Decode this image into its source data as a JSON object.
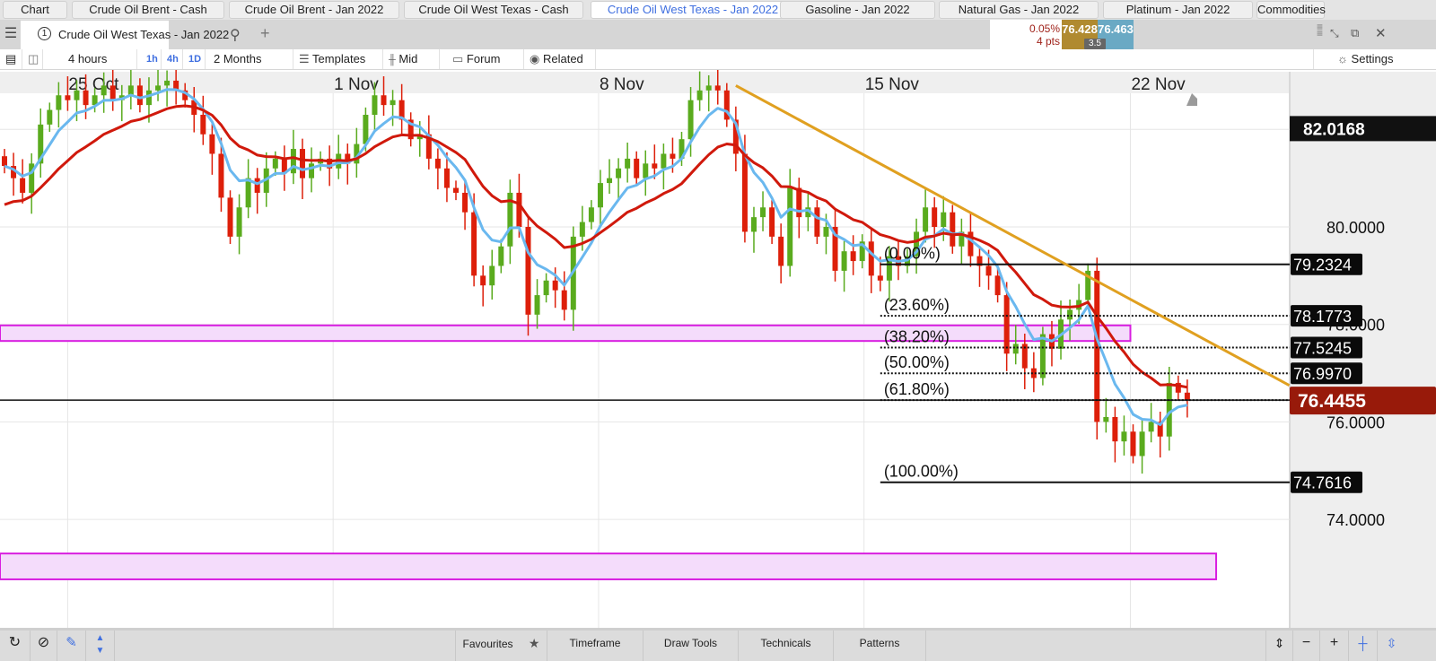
{
  "tabs": [
    {
      "label": "Chart",
      "active": false
    },
    {
      "label": "Crude Oil Brent - Cash",
      "active": false
    },
    {
      "label": "Crude Oil Brent - Jan 2022",
      "active": false
    },
    {
      "label": "Crude Oil West Texas - Cash",
      "active": false
    },
    {
      "label": "Crude Oil West Texas - Jan 2022",
      "active": true
    },
    {
      "label": "Gasoline - Jan 2022",
      "active": false
    },
    {
      "label": "Natural Gas - Jan 2022",
      "active": false
    },
    {
      "label": "Platinum - Jan 2022",
      "active": false
    },
    {
      "label": "Commodities",
      "active": false
    }
  ],
  "instrument": {
    "number": "1",
    "name": "Crude Oil West Texas - Jan 2022",
    "add_label": "+"
  },
  "quote": {
    "change_pct": "0.05%",
    "change_pts": "4 pts",
    "direction": "down",
    "sell": "76.428",
    "buy": "76.463",
    "spread": "3.5",
    "sell_color": "#b08a30",
    "buy_color": "#6aa9c4"
  },
  "toolbar": {
    "interval": "4 hours",
    "quick_intervals": [
      "1h",
      "4h",
      "1D"
    ],
    "range": "2 Months",
    "templates": "Templates",
    "price_type": "Mid",
    "forum": "Forum",
    "related": "Related",
    "settings": "Settings"
  },
  "bottom_bar": {
    "favourites": "Favourites",
    "timeframe": "Timeframe",
    "draw_tools": "Draw Tools",
    "technicals": "Technicals",
    "patterns": "Patterns"
  },
  "chart_data": {
    "type": "candlestick",
    "interval": "4 hours",
    "up_color": "#5aab1e",
    "down_color": "#dd1f0a",
    "x_ticks": [
      {
        "label": "25 Oct",
        "index": 7
      },
      {
        "label": "1 Nov",
        "index": 36.4
      },
      {
        "label": "8 Nov",
        "index": 65.8
      },
      {
        "label": "15 Nov",
        "index": 95.2
      },
      {
        "label": "22 Nov",
        "index": 124.7
      }
    ],
    "y_ticks": [
      "80.0000",
      "78.0000",
      "76.0000",
      "74.0000"
    ],
    "y_tick_values": [
      80,
      78,
      76,
      74
    ],
    "ylim": [
      71.5,
      83.2
    ],
    "high_label": {
      "value": 82.0168,
      "text": "82.0168"
    },
    "current_price": {
      "value": 76.4455,
      "text": "76.4455",
      "color": "#981a0a"
    },
    "closes": [
      81.25,
      81.0,
      80.7,
      81.3,
      82.1,
      82.4,
      82.7,
      82.6,
      82.8,
      82.5,
      82.7,
      82.9,
      82.6,
      82.7,
      82.9,
      82.5,
      82.8,
      82.9,
      83.0,
      82.8,
      82.6,
      82.3,
      81.9,
      81.5,
      80.6,
      79.8,
      80.4,
      81.0,
      80.7,
      81.2,
      81.4,
      81.1,
      81.6,
      81.0,
      81.3,
      81.4,
      81.2,
      81.5,
      81.3,
      81.7,
      82.3,
      82.7,
      82.5,
      82.6,
      82.2,
      81.8,
      81.9,
      81.4,
      81.2,
      80.8,
      80.7,
      80.3,
      79.0,
      78.8,
      79.2,
      79.6,
      80.7,
      80.0,
      78.2,
      78.6,
      78.9,
      78.7,
      78.3,
      79.8,
      80.1,
      80.4,
      80.9,
      81.0,
      81.2,
      81.4,
      81.0,
      81.3,
      81.2,
      81.5,
      81.4,
      81.8,
      82.6,
      82.8,
      82.9,
      82.8,
      82.2,
      81.5,
      79.9,
      80.2,
      80.4,
      79.8,
      79.2,
      80.8,
      80.2,
      80.4,
      79.8,
      80.0,
      79.1,
      79.5,
      79.3,
      79.7,
      79.0,
      78.9,
      79.4,
      79.2,
      79.4,
      79.9,
      80.4,
      80.0,
      80.3,
      79.6,
      79.9,
      79.4,
      79.2,
      79.0,
      78.6,
      77.4,
      77.6,
      77.1,
      76.9,
      77.8,
      77.5,
      78.1,
      78.3,
      78.5,
      79.1,
      76.0,
      76.1,
      75.6,
      75.8,
      75.3,
      75.8,
      76.0,
      75.7,
      76.8,
      76.6,
      76.45
    ],
    "moving_averages": [
      {
        "color": "#6ab8ef",
        "kind": "fast"
      },
      {
        "color": "#d0190c",
        "kind": "slow"
      }
    ],
    "trendline": {
      "color": "#e0a020",
      "start": {
        "index": 81,
        "price": 82.9
      },
      "end": {
        "index": 142.3,
        "price": 76.75
      }
    },
    "fibonacci": {
      "start_index": 97,
      "levels": [
        {
          "label": "(0.00%)",
          "value": 79.2324,
          "text": "79.2324",
          "style": "solid"
        },
        {
          "label": "(23.60%)",
          "value": 78.1773,
          "text": "78.1773",
          "style": "dotted"
        },
        {
          "label": "(38.20%)",
          "value": 77.5245,
          "text": "77.5245",
          "style": "dotted"
        },
        {
          "label": "(50.00%)",
          "value": 76.997,
          "text": "76.9970",
          "style": "dotted"
        },
        {
          "label": "(61.80%)",
          "value": 76.4455,
          "text": "",
          "style": "dotted"
        },
        {
          "label": "(100.00%)",
          "value": 74.7616,
          "text": "74.7616",
          "style": "solid"
        }
      ]
    },
    "zones": [
      {
        "from": 77.66,
        "to": 77.98,
        "end_index": 124.7,
        "color": "#d81ee0"
      },
      {
        "from": 72.77,
        "to": 73.3,
        "end_index": 134.2,
        "color": "#d81ee0"
      }
    ]
  }
}
